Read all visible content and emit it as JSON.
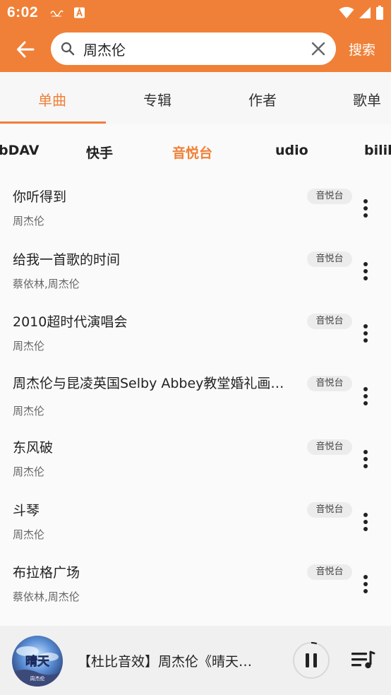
{
  "status_bar": {
    "time": "6:02",
    "icons": [
      "app-notification-icon",
      "a-notification-icon",
      "wifi-icon",
      "signal-icon",
      "battery-icon"
    ]
  },
  "search": {
    "query": "周杰伦",
    "submit_label": "搜索"
  },
  "main_tabs": [
    {
      "label": "单曲",
      "active": true
    },
    {
      "label": "专辑",
      "active": false
    },
    {
      "label": "作者",
      "active": false
    },
    {
      "label": "歌单",
      "active": false
    }
  ],
  "source_tabs": [
    {
      "label": "bDAV",
      "active": false
    },
    {
      "label": "快手",
      "active": false
    },
    {
      "label": "音悦台",
      "active": true
    },
    {
      "label": "udio",
      "active": false
    },
    {
      "label": "bilib",
      "active": false
    }
  ],
  "songs": [
    {
      "title": "你听得到",
      "artist": "周杰伦",
      "source": "音悦台"
    },
    {
      "title": "给我一首歌的时间",
      "artist": "蔡依林,周杰伦",
      "source": "音悦台"
    },
    {
      "title": "2010超时代演唱会",
      "artist": "周杰伦",
      "source": "音悦台"
    },
    {
      "title": "周杰伦与昆凌英国Selby Abbey教堂婚礼画…",
      "artist": "周杰伦",
      "source": "音悦台"
    },
    {
      "title": "东风破",
      "artist": "周杰伦",
      "source": "音悦台"
    },
    {
      "title": "斗琴",
      "artist": "周杰伦",
      "source": "音悦台"
    },
    {
      "title": "布拉格广场",
      "artist": "蔡依林,周杰伦",
      "source": "音悦台"
    }
  ],
  "player": {
    "now_playing": "【杜比音效】周杰伦《晴天…",
    "album_art_text": "晴天",
    "album_art_caption": "周杰伦",
    "state": "playing",
    "progress": 0.05
  },
  "colors": {
    "accent": "#f08037",
    "background": "#fafafa",
    "badge_bg": "#ececec",
    "player_bg": "#f0f0f0"
  }
}
